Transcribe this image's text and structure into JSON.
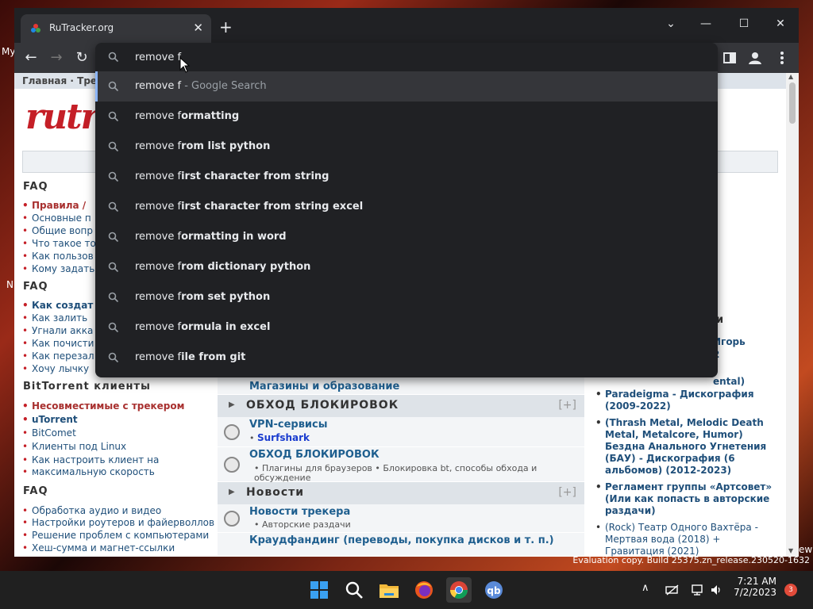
{
  "browser": {
    "tab_title": "RuTracker.org",
    "new_tab": "+",
    "window_controls": {
      "minimize": "—",
      "maximize": "☐",
      "close": "✕",
      "tab_search": "⌄"
    }
  },
  "omnibox": {
    "query": "remove f",
    "suggestions": [
      {
        "prefix": "remove f",
        "suffix": "",
        "note": " - Google Search"
      },
      {
        "prefix": "remove f",
        "suffix": "ormatting",
        "note": ""
      },
      {
        "prefix": "remove f",
        "suffix": "rom list python",
        "note": ""
      },
      {
        "prefix": "remove f",
        "suffix": "irst character from string",
        "note": ""
      },
      {
        "prefix": "remove f",
        "suffix": "irst character from string excel",
        "note": ""
      },
      {
        "prefix": "remove f",
        "suffix": "ormatting in word",
        "note": ""
      },
      {
        "prefix": "remove f",
        "suffix": "rom dictionary python",
        "note": ""
      },
      {
        "prefix": "remove f",
        "suffix": "rom set python",
        "note": ""
      },
      {
        "prefix": "remove f",
        "suffix": "ormula in excel",
        "note": ""
      },
      {
        "prefix": "remove f",
        "suffix": "ile from git",
        "note": ""
      }
    ]
  },
  "page": {
    "topnav": "Главная · Тре",
    "logo": "rutra",
    "left": {
      "faq1": "FAQ",
      "faq1_items": [
        "Правила / ",
        "Основные п",
        "Общие вопр",
        "Что такое то",
        "Как пользов",
        "Кому задать"
      ],
      "faq2": "FAQ",
      "faq2_items": [
        "Как создат",
        "Как залить",
        "Угнали акка",
        "Как почисти",
        "Как перезал",
        "Хочу лычку"
      ],
      "bt": "BitTorrent клиенты",
      "bt_items": [
        "Несовместимые с трекером",
        "uTorrent",
        "BitComet",
        "Клиенты под Linux",
        "Как настроить клиент на",
        "максимальную скорость"
      ],
      "faq3": "FAQ",
      "faq3_items": [
        "Обработка аудио и видео",
        "Настройки роутеров и файерволлов",
        "Решение проблем с компьютерами",
        "Хеш-сумма и магнет-ссылки"
      ]
    },
    "middle": {
      "partial_forum": "Магазины и образование",
      "cat1": "ОБХОД БЛОКИРОВОК",
      "plus": "[+]",
      "f1_title": "VPN-сервисы",
      "f1_sub": "Surfshark",
      "f2_title": "ОБХОД БЛОКИРОВОК",
      "f2_sub1": "• Плагины для браузеров  • Блокировка bt, способы обхода и",
      "f2_sub2": "обсуждение",
      "cat2": "Новости",
      "f3_title": "Новости трекера",
      "f3_sub": "• Авторские раздачи",
      "f4_title": "Краудфандинг (переводы, покупка дисков и т. п.)"
    },
    "right": {
      "frag1": "и",
      "frag2": "Игорь",
      "frag3": "2",
      "frag4": "-",
      "frag5": "ental)",
      "item1": "Paradeigma - Дискография (2009-2022)",
      "item2": "(Thrash Metal, Melodic Death Metal, Metalcore, Humor) Бездна Анального Угнетения (БАУ) - Дискография (6 альбомов) (2012-2023)",
      "item3": "Регламент группы «Артсовет» (Или как попасть в авторские раздачи)",
      "item4": "(Rock) Театр Одного Вахтёра - Мертвая вода (2018) + Гравитация (2021)"
    }
  },
  "desktop": {
    "frag_my": "My",
    "frag_n": "N",
    "frag_ew": "ew"
  },
  "system": {
    "watermark": "Evaluation copy. Build 25375.zn_release.230520-1632",
    "time": "7:21 AM",
    "date": "7/2/2023",
    "notifications": "3"
  },
  "colors": {
    "accent": "#8ab4f8",
    "brand_red": "#c51f27",
    "omni_bg": "#202124"
  }
}
